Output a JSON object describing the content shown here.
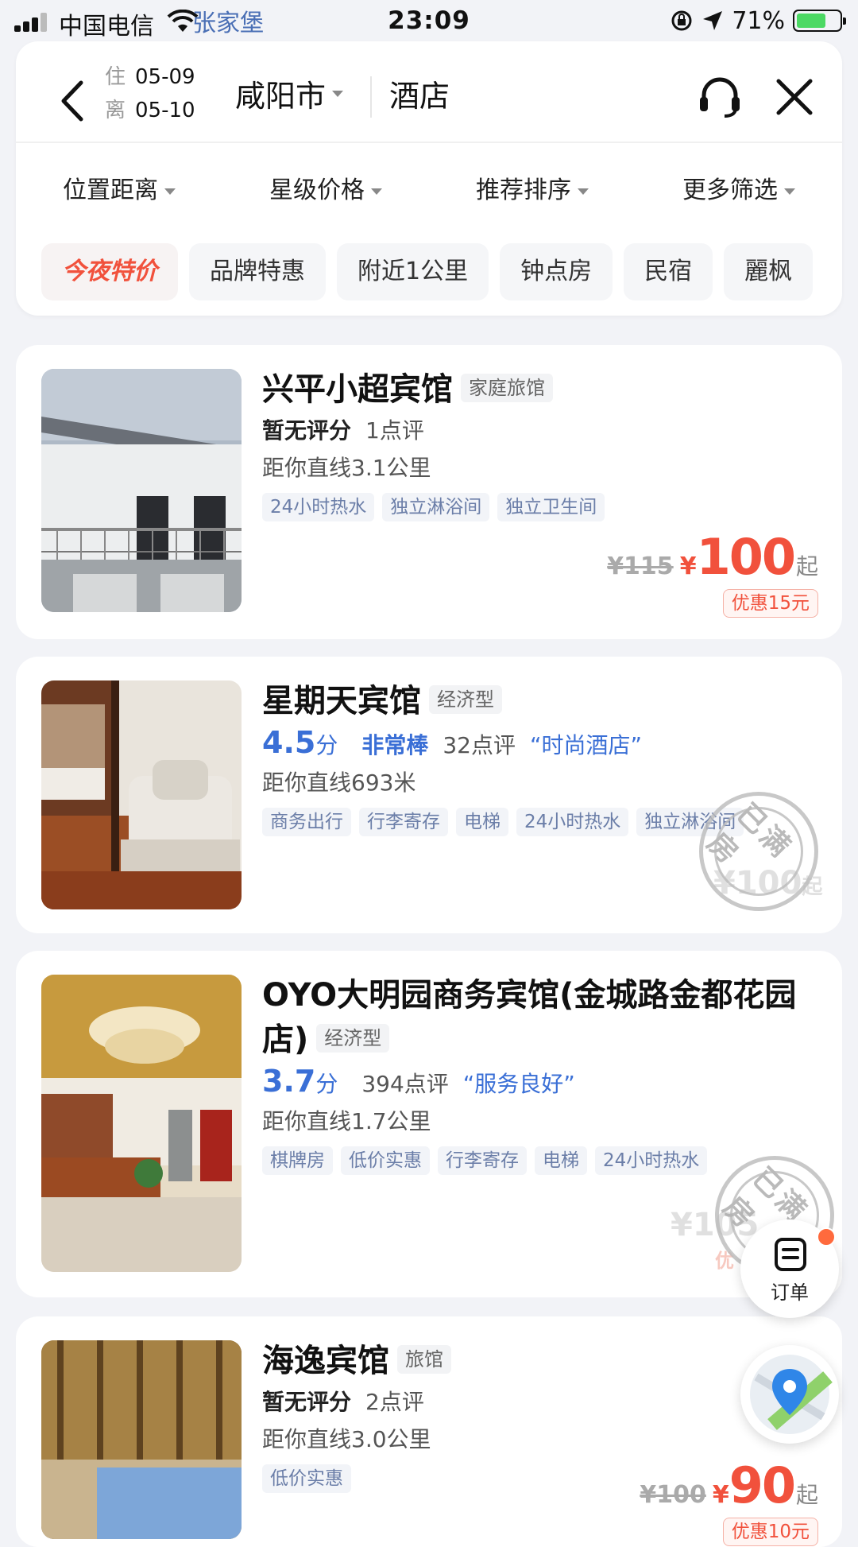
{
  "status_bar": {
    "carrier": "中国电信",
    "overlay_text": "张家堡",
    "time": "23:09",
    "battery": "71%"
  },
  "header": {
    "checkin_label": "住",
    "checkin_date": "05-09",
    "checkout_label": "离",
    "checkout_date": "05-10",
    "city": "咸阳市",
    "keyword": "酒店"
  },
  "filters": [
    "位置距离",
    "星级价格",
    "推荐排序",
    "更多筛选"
  ],
  "chips": [
    "今夜特价",
    "品牌特惠",
    "附近1公里",
    "钟点房",
    "民宿",
    "麗枫"
  ],
  "hotels": [
    {
      "name": "兴平小超宾馆",
      "type": "家庭旅馆",
      "rating_text": "暂无评分",
      "reviews": "1点评",
      "distance": "距你直线3.1公里",
      "amenities": [
        "24小时热水",
        "独立淋浴间",
        "独立卫生间"
      ],
      "orig_price": "¥115",
      "yen": "¥",
      "price": "100",
      "qi": "起",
      "discount": "优惠15元"
    },
    {
      "name": "星期天宾馆",
      "type": "经济型",
      "score": "4.5",
      "score_unit": "分",
      "level": "非常棒",
      "reviews": "32点评",
      "quote": "“时尚酒店”",
      "distance": "距你直线693米",
      "amenities": [
        "商务出行",
        "行李寄存",
        "电梯",
        "24小时热水",
        "独立淋浴间"
      ],
      "stamp": "已满房",
      "faded_price": "¥100",
      "qi": "起"
    },
    {
      "name": "OYO大明园商务宾馆(金城路金都花园店)",
      "type": "经济型",
      "score": "3.7",
      "score_unit": "分",
      "reviews": "394点评",
      "quote": "“服务良好”",
      "distance": "距你直线1.7公里",
      "amenities": [
        "棋牌房",
        "低价实惠",
        "行李寄存",
        "电梯",
        "24小时热水"
      ],
      "stamp": "已满房",
      "faded_price": "¥105",
      "faded_disc": "优"
    },
    {
      "name": "海逸宾馆",
      "type": "旅馆",
      "rating_text": "暂无评分",
      "reviews": "2点评",
      "distance": "距你直线3.0公里",
      "amenities": [
        "低价实惠"
      ],
      "orig_price": "¥100",
      "yen": "¥",
      "price": "90",
      "qi": "起",
      "discount": "优惠10元"
    }
  ],
  "fab": {
    "order_label": "订单"
  }
}
